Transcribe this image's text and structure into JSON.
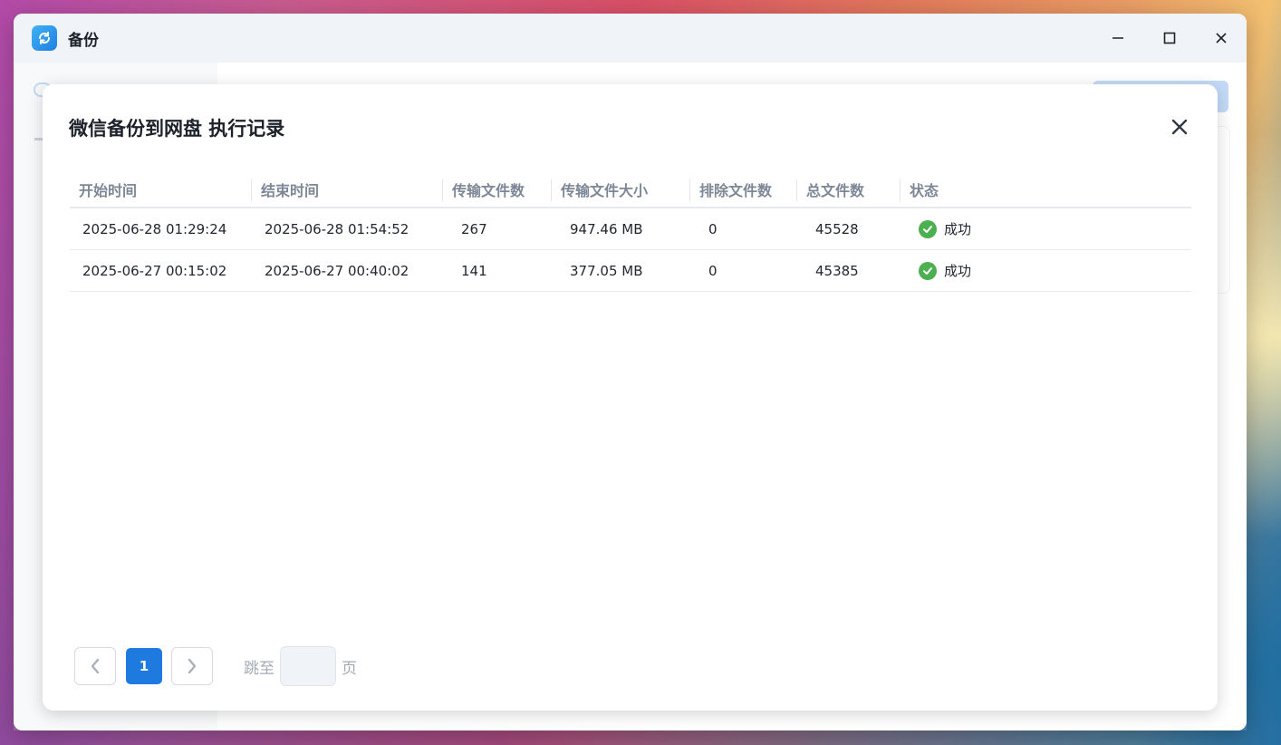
{
  "app": {
    "title": "备份"
  },
  "dialog": {
    "title": "微信备份到网盘 执行记录",
    "columns": [
      "开始时间",
      "结束时间",
      "传输文件数",
      "传输文件大小",
      "排除文件数",
      "总文件数",
      "状态"
    ],
    "rows": [
      {
        "start": "2025-06-28 01:29:24",
        "end": "2025-06-28 01:54:52",
        "transferred": "267",
        "size": "947.46 MB",
        "excluded": "0",
        "total": "45528",
        "status": "成功"
      },
      {
        "start": "2025-06-27 00:15:02",
        "end": "2025-06-27 00:40:02",
        "transferred": "141",
        "size": "377.05 MB",
        "excluded": "0",
        "total": "45385",
        "status": "成功"
      }
    ]
  },
  "pagination": {
    "current_page": "1",
    "jump_label": "跳至",
    "page_label": "页",
    "jump_value": ""
  },
  "colors": {
    "accent": "#1f7ae0",
    "success": "#4caf50",
    "header_text": "#7d8796"
  },
  "icons": [
    "app-backup-icon",
    "minimize-icon",
    "maximize-icon",
    "close-icon",
    "dialog-close-icon",
    "success-check-icon",
    "chevron-left-icon",
    "chevron-right-icon"
  ]
}
